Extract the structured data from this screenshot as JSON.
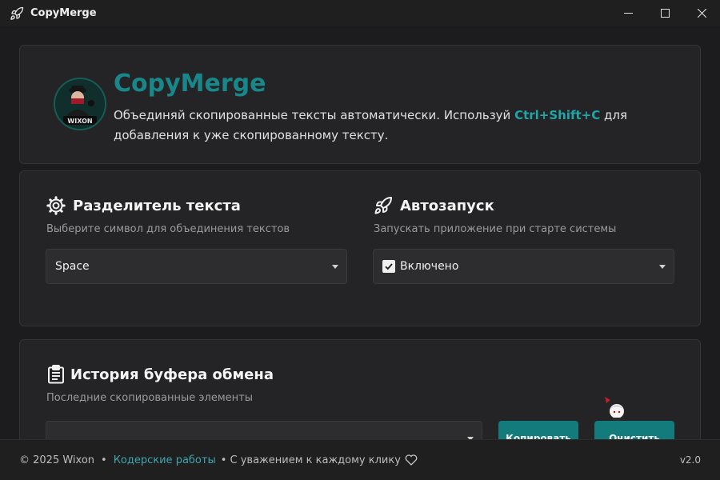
{
  "window": {
    "title": "CopyMerge",
    "icon": "rocket-icon",
    "controls": [
      "minimize-icon",
      "maximize-icon",
      "close-icon"
    ]
  },
  "header": {
    "app_name": "CopyMerge",
    "description_before": "Объединяй скопированные тексты автоматически. Используй ",
    "hotkey": "Ctrl+Shift+C",
    "description_after": " для добавления к уже скопированному тексту.",
    "avatar_text": "WIXON"
  },
  "separator": {
    "icon": "gear-icon",
    "title": "Разделитель текста",
    "subtitle": "Выберите символ для объединения текстов",
    "selected": "Space"
  },
  "autostart": {
    "icon": "rocket-icon",
    "title": "Автозапуск",
    "subtitle": "Запускать приложение при старте системы",
    "selected": "Включено",
    "checked": true
  },
  "history": {
    "icon": "clipboard-icon",
    "title": "История буфера обмена",
    "subtitle": "Последние скопированные элементы",
    "selected": "",
    "copy_button": "Копировать",
    "clear_button": "Очистить"
  },
  "footer": {
    "copyright": "© 2025 Wixon",
    "bullet": "•",
    "link": "Кодерские работы",
    "tagline": "• С уважением к каждому клику",
    "heart_icon": "heart-icon",
    "version": "v2.0"
  },
  "colors": {
    "accent": "#19878a",
    "button": "#137b7b",
    "background": "#1c1c1e",
    "card": "#242426"
  }
}
